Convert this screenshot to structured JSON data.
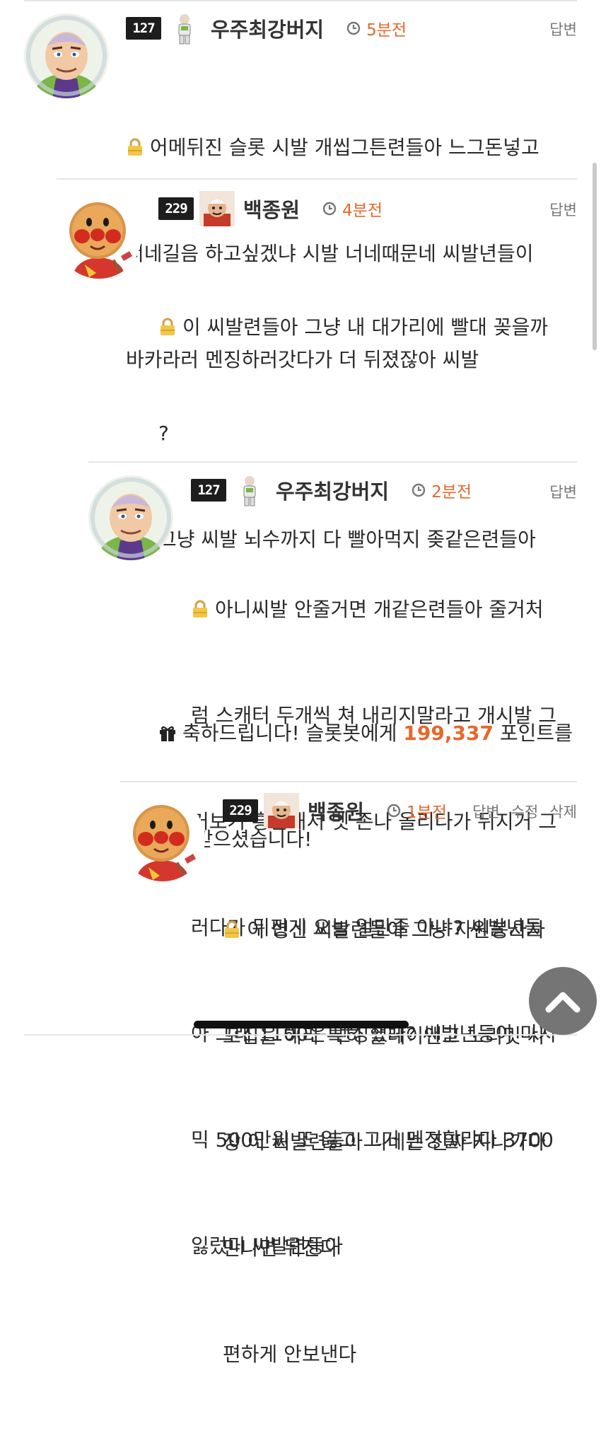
{
  "comments": [
    {
      "level": "127",
      "nickname": "우주최강버지",
      "time": "5분전",
      "actions": [
        "답변"
      ],
      "lines": [
        "어메뒤진 슬롯 시발 개씹그튼련들아 느그돈넣고",
        "너네길음 하고싶겠냐 시발 너네때문네 씨발년들이",
        "바카라러 멘징하러갓다가 더 뒤졌잖아 씨발"
      ],
      "avatar_icon": "buzz-lightyear-avatar"
    },
    {
      "level": "229",
      "nickname": "백종원",
      "time": "4분전",
      "actions": [
        "답변"
      ],
      "lines": [
        "이 씨발련들아 그냥 내 대가리에 빨대 꽂을까",
        "?",
        "그냥 씨발 뇌수까지 다 빨아먹지 좆같은련들아"
      ],
      "gift": {
        "prefix": "축하드립니다! 슬롯봇에게 ",
        "points": "199,337",
        "suffix": " 포인트를",
        "line2": "선물받으셨습니다!"
      },
      "avatar_icon": "anpanman-avatar"
    },
    {
      "level": "127",
      "nickname": "우주최강버지",
      "time": "2분전",
      "actions": [
        "답변"
      ],
      "lines": [
        "아니씨발 안줄거면 개같은련들아 줄거처",
        "럼 스캐터 두개씩 쳐 내리지말라고 개시발 그",
        "거보거 흥분해서 벳 존나 올리다가 뒤지거 그",
        "러다가 뒤진게 오늘 얼만줄 아냐? 씨발년들",
        "아 그래 1100은 멘징했다? 씨발년등아 마지",
        "믹 500만원 또 잃고 그거 멘징할랴다 3700",
        "잃렀디 씨발련등아"
      ],
      "avatar_icon": "buzz-lightyear-avatar"
    },
    {
      "level": "229",
      "nickname": "백종원",
      "time": "1분전",
      "actions": [
        "답변",
        "수정",
        "삭제"
      ],
      "lines": [
        "이 병신 씨발련들아 그냥 자원봉사자",
        "모집을 해라 특히 플레이앤고 노리밋 사",
        "장 이 씨발련들아 니네는 진짜 지나가다",
        "만나면 뒤진다",
        "편하게 안보낸다"
      ],
      "avatar_icon": "anpanman-avatar"
    }
  ],
  "colors": {
    "accent": "#e8672a",
    "level_badge": "#1d1d1d",
    "separator": "#e6e6e6"
  },
  "icons": {
    "lock": "lock-icon",
    "clock": "clock-icon",
    "gift": "gift-icon",
    "top": "chevron-up-icon"
  }
}
